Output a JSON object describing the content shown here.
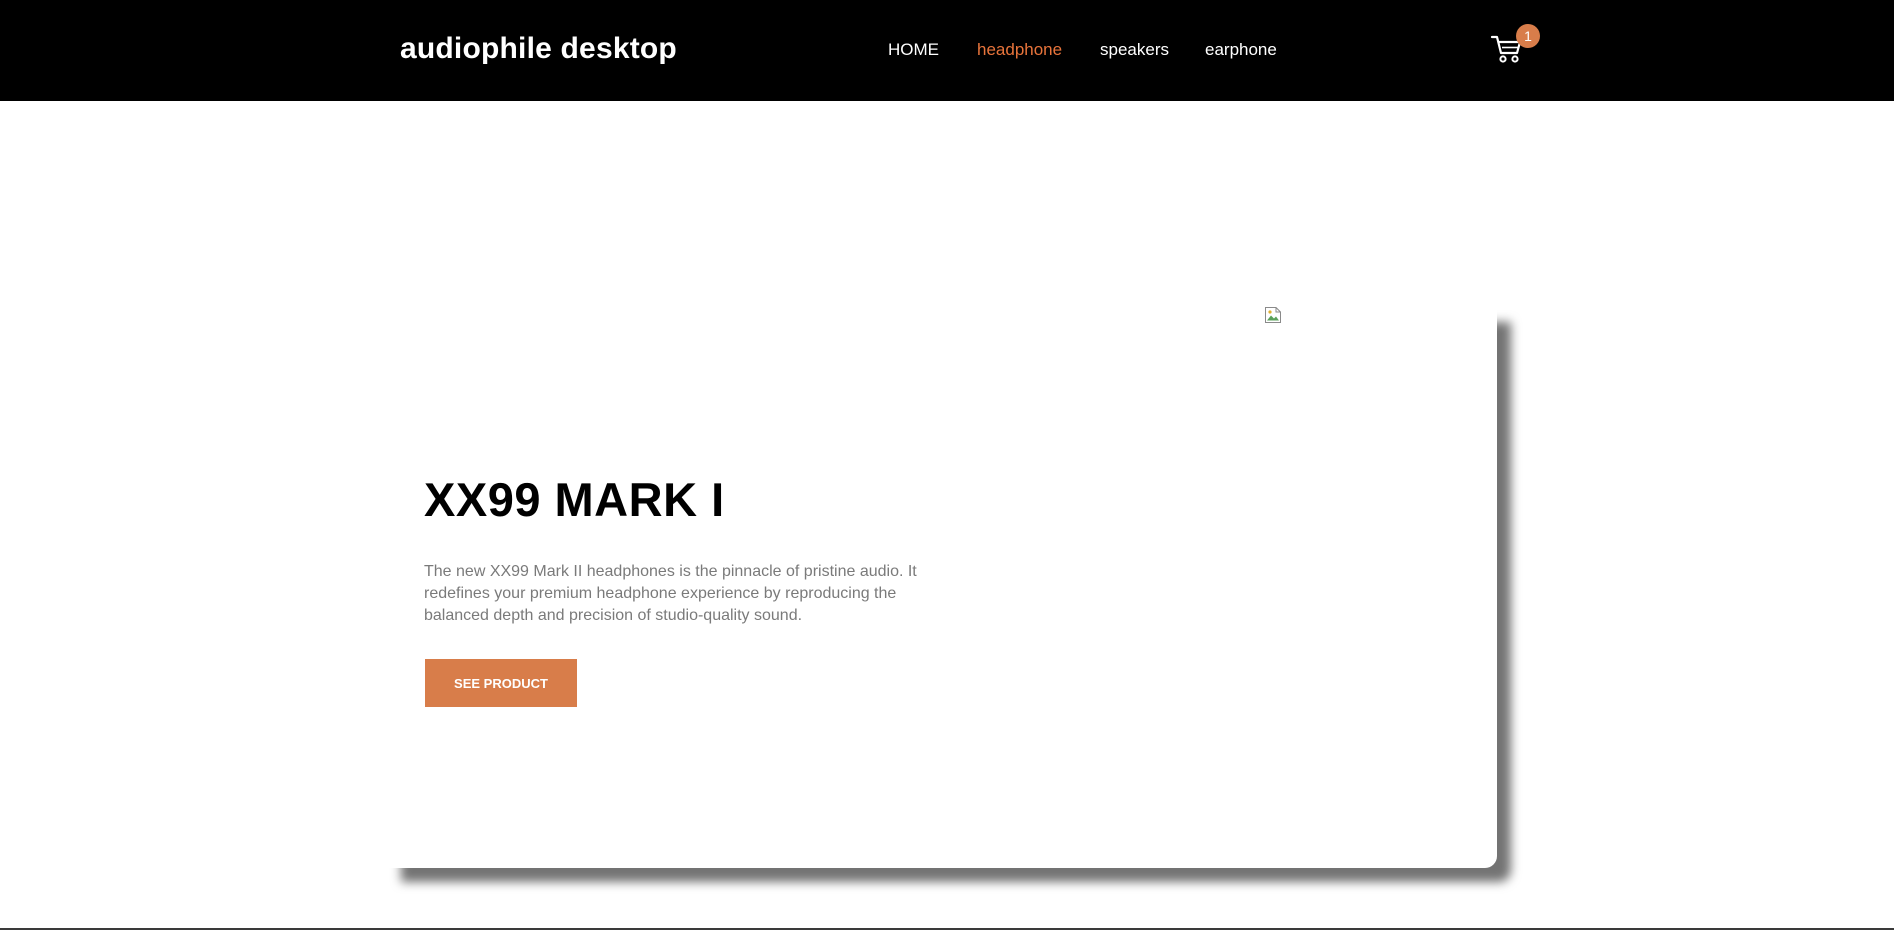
{
  "header": {
    "logo": "audiophile desktop",
    "nav": [
      {
        "label": "HOME",
        "active": false
      },
      {
        "label": "headphone",
        "active": true
      },
      {
        "label": "speakers",
        "active": false
      },
      {
        "label": "earphone",
        "active": false
      }
    ],
    "cart": {
      "icon": "cart-icon",
      "count": "1"
    }
  },
  "hero": {
    "title": "XX99 MARK I",
    "description": "The new XX99 Mark II headphones is the pinnacle of pristine audio. It redefines your premium headphone experience by reproducing the balanced depth and precision of studio-quality sound.",
    "button_label": "SEE PRODUCT",
    "image_icon": "broken-image-icon"
  },
  "colors": {
    "header_bg": "#000000",
    "accent": "#d87d4a",
    "nav_active": "#e8743b",
    "body_text": "#7a7a7a"
  }
}
